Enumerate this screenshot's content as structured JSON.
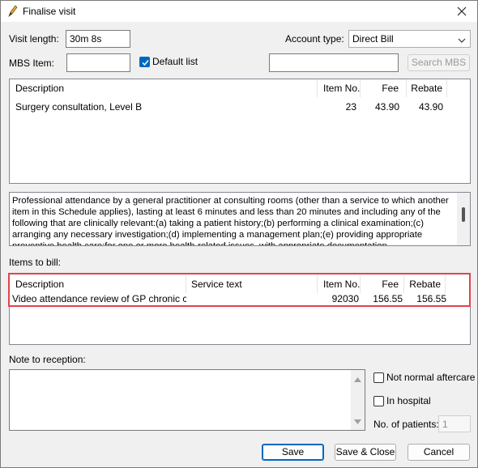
{
  "window": {
    "title": "Finalise visit"
  },
  "visit_length": {
    "label": "Visit length:",
    "value": "30m  8s"
  },
  "account_type": {
    "label": "Account type:",
    "value": "Direct Bill"
  },
  "mbs_item": {
    "label": "MBS Item:",
    "value": "",
    "default_list_label": "Default list",
    "default_list_checked": true,
    "search_value": "",
    "search_button": "Search MBS"
  },
  "mbs_list": {
    "columns": [
      "Description",
      "Item No.",
      "Fee",
      "Rebate"
    ],
    "rows": [
      {
        "description": "Surgery consultation, Level B",
        "item_no": "23",
        "fee": "43.90",
        "rebate": "43.90"
      }
    ]
  },
  "item_description": "Professional attendance by a general practitioner at consulting rooms (other than a service to which another item in this Schedule applies), lasting at least 6 minutes and less than 20 minutes and including any of the following that are clinically relevant:(a) taking a patient history;(b) performing a clinical examination;(c) arranging any necessary investigation;(d) implementing a management plan;(e) providing appropriate preventive health care;for one or more health-related issues, with appropriate documentation.",
  "items_to_bill": {
    "label": "Items to bill:",
    "columns": [
      "Description",
      "Service text",
      "Item No.",
      "Fee",
      "Rebate"
    ],
    "rows": [
      {
        "description": "Video attendance review of GP chronic condi",
        "service_text": "",
        "item_no": "92030",
        "fee": "156.55",
        "rebate": "156.55"
      }
    ]
  },
  "note": {
    "label": "Note to reception:",
    "value": ""
  },
  "options": {
    "not_normal_aftercare": "Not normal aftercare",
    "in_hospital": "In hospital",
    "patients_label": "No. of patients:",
    "patients_value": "1"
  },
  "buttons": {
    "save": "Save",
    "save_close": "Save & Close",
    "cancel": "Cancel"
  },
  "colors": {
    "accent": "#0067c0",
    "highlight": "#e0454f"
  }
}
